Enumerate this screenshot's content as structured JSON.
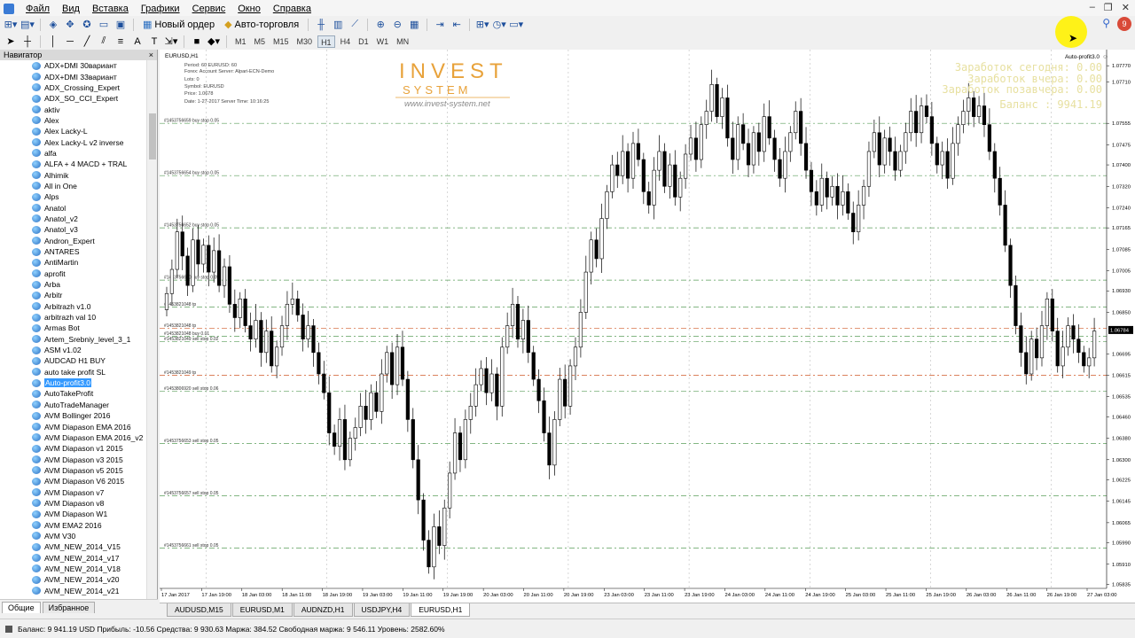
{
  "menu": [
    "Файл",
    "Вид",
    "Вставка",
    "Графики",
    "Сервис",
    "Окно",
    "Справка"
  ],
  "toolbar": {
    "new_order": "Новый ордер",
    "autotrading": "Авто-торговля"
  },
  "timeframes": [
    "M1",
    "M5",
    "M15",
    "M30",
    "H1",
    "H4",
    "D1",
    "W1",
    "MN"
  ],
  "active_timeframe": "H1",
  "navigator": {
    "title": "Навигатор",
    "items": [
      "ADX+DMI 30вариант",
      "ADX+DMI 33вариант",
      "ADX_Crossing_Expert",
      "ADX_SO_CCI_Expert",
      "aktiv",
      "Alex",
      "Alex Lacky-L",
      "Alex Lacky-L v2 inverse",
      "alfa",
      "ALFA + 4 MACD + TRAL",
      "Alhimik",
      "All in One",
      "Alps",
      "Anatol",
      "Anatol_v2",
      "Anatol_v3",
      "Andron_Expert",
      "ANTARES",
      "AntiMartin",
      "aprofit",
      "Arba",
      "Arbitr",
      "Arbitrazh v1.0",
      "arbitrazh val 10",
      "Armas Bot",
      "Artem_Srebniy_level_3_1",
      "ASM v1.02",
      "AUDCAD H1 BUY",
      "auto take profit SL",
      "Auto-profit3.0",
      "AutoTakeProfit",
      "AutoTradeManager",
      "AVM Bollinger 2016",
      "AVM Diapason EMA 2016",
      "AVM Diapason EMA 2016_v2",
      "AVM Diapason v1 2015",
      "AVM Diapason v3 2015",
      "AVM Diapason v5 2015",
      "AVM Diapason V6 2015",
      "AVM Diapason v7",
      "AVM Diapason v8",
      "AVM Diapason W1",
      "AVM EMA2 2016",
      "AVM V30",
      "AVM_NEW_2014_V15",
      "AVM_NEW_2014_v17",
      "AVM_NEW_2014_V18",
      "AVM_NEW_2014_v20",
      "AVM_NEW_2014_v21"
    ],
    "selected": "Auto-profit3.0",
    "tabs": [
      "Общие",
      "Избранное"
    ]
  },
  "chart": {
    "symbol_label": "EURUSD,H1",
    "expert_label": "Auto-profit3.0",
    "info_lines": [
      "Period: 60   EURUSD: 60",
      "Forex: Account Server: Alpari-ECN-Demo",
      "Lots: 0",
      "Symbol: EURUSD",
      "Price: 1.0678",
      "Date: 1-27-2017 Server Time: 10:16:25"
    ],
    "logo_line1": "INVEST",
    "logo_line2": "SYSTEM",
    "logo_url": "www.invest-system.net",
    "earnings": [
      "Заработок сегодня: 0.00",
      "Заработок вчера: 0.00",
      "Заработок позавчера: 0.00",
      "Баланс : 9941.19"
    ],
    "current_price": "1.06784"
  },
  "chart_data": {
    "type": "candlestick",
    "symbol": "EURUSD",
    "timeframe": "H1",
    "ylim": [
      1.0582,
      1.0783
    ],
    "y_ticks": [
      "1.07770",
      "1.07710",
      "1.07555",
      "1.07475",
      "1.07400",
      "1.07320",
      "1.07240",
      "1.07165",
      "1.07085",
      "1.07005",
      "1.06930",
      "1.06850",
      "1.06784",
      "1.06695",
      "1.06615",
      "1.06535",
      "1.06460",
      "1.06380",
      "1.06300",
      "1.06225",
      "1.06145",
      "1.06065",
      "1.05990",
      "1.05910",
      "1.05835"
    ],
    "x_ticks": [
      "17 Jan 2017",
      "17 Jan 19:00",
      "18 Jan 03:00",
      "18 Jan 11:00",
      "18 Jan 19:00",
      "19 Jan 03:00",
      "19 Jan 11:00",
      "19 Jan 19:00",
      "20 Jan 03:00",
      "20 Jan 11:00",
      "20 Jan 19:00",
      "23 Jan 03:00",
      "23 Jan 11:00",
      "23 Jan 19:00",
      "24 Jan 03:00",
      "24 Jan 11:00",
      "24 Jan 19:00",
      "25 Jan 03:00",
      "25 Jan 11:00",
      "25 Jan 19:00",
      "26 Jan 03:00",
      "26 Jan 11:00",
      "26 Jan 19:00",
      "27 Jan 03:00"
    ],
    "order_levels": [
      {
        "label": "#1453756659 buy stop 0.05",
        "price": 1.07555,
        "color": "#5a9e5a"
      },
      {
        "label": "#1453756654 buy stop 0.05",
        "price": 1.0736,
        "color": "#5a9e5a"
      },
      {
        "label": "#1453756652 buy stop 0.05",
        "price": 1.07165,
        "color": "#5a9e5a"
      },
      {
        "label": "#1453756650 buy stop 0.05",
        "price": 1.0697,
        "color": "#5a9e5a"
      },
      {
        "label": "#1453821048 tp",
        "price": 1.0687,
        "color": "#5a9e5a"
      },
      {
        "label": "#1453821048 tp",
        "price": 1.0679,
        "color": "#d05a28"
      },
      {
        "label": "#1453821048 buy 0.01",
        "price": 1.0676,
        "color": "#5a9e5a"
      },
      {
        "label": "#1453821049 sell stop 0.02",
        "price": 1.0674,
        "color": "#5a9e5a"
      },
      {
        "label": "#1453821049 tp",
        "price": 1.06615,
        "color": "#d05a28"
      },
      {
        "label": "#1453806920 sell stop 0.06",
        "price": 1.06555,
        "color": "#5a9e5a"
      },
      {
        "label": "#1453756653 sell stop 0.05",
        "price": 1.0636,
        "color": "#5a9e5a"
      },
      {
        "label": "#1453756657 sell stop 0.05",
        "price": 1.06165,
        "color": "#5a9e5a"
      },
      {
        "label": "#1453756661 sell stop 0.05",
        "price": 1.0597,
        "color": "#5a9e5a"
      }
    ],
    "closes": [
      1.0692,
      1.0701,
      1.0715,
      1.0706,
      1.0695,
      1.0712,
      1.0703,
      1.071,
      1.07,
      1.0708,
      1.0695,
      1.0702,
      1.0688,
      1.0683,
      1.069,
      1.068,
      1.0675,
      1.0682,
      1.067,
      1.0678,
      1.0665,
      1.0672,
      1.068,
      1.0688,
      1.069,
      1.0684,
      1.0675,
      1.068,
      1.067,
      1.0662,
      1.0655,
      1.064,
      1.0635,
      1.0645,
      1.063,
      1.0638,
      1.0642,
      1.065,
      1.0645,
      1.0655,
      1.0648,
      1.0662,
      1.067,
      1.0658,
      1.0672,
      1.066,
      1.0645,
      1.063,
      1.0615,
      1.06,
      1.059,
      1.0605,
      1.0598,
      1.0612,
      1.0625,
      1.064,
      1.063,
      1.0645,
      1.065,
      1.0658,
      1.0664,
      1.0655,
      1.0662,
      1.065,
      1.0672,
      1.068,
      1.0688,
      1.0675,
      1.0682,
      1.067,
      1.066,
      1.0652,
      1.064,
      1.0628,
      1.0645,
      1.066,
      1.065,
      1.0665,
      1.0672,
      1.0685,
      1.07,
      1.0712,
      1.0705,
      1.072,
      1.073,
      1.074,
      1.0736,
      1.0745,
      1.0735,
      1.0748,
      1.0742,
      1.073,
      1.0725,
      1.0738,
      1.0745,
      1.0732,
      1.074,
      1.0728,
      1.0735,
      1.0744,
      1.075,
      1.0742,
      1.0755,
      1.076,
      1.077,
      1.0758,
      1.0765,
      1.075,
      1.0742,
      1.0755,
      1.0748,
      1.074,
      1.0752,
      1.0745,
      1.0758,
      1.075,
      1.0742,
      1.0735,
      1.0745,
      1.0752,
      1.076,
      1.0748,
      1.0738,
      1.073,
      1.0725,
      1.0735,
      1.0728,
      1.0732,
      1.0725,
      1.073,
      1.0722,
      1.0715,
      1.0725,
      1.0732,
      1.0745,
      1.0752,
      1.074,
      1.075,
      1.0745,
      1.0738,
      1.0745,
      1.0752,
      1.076,
      1.0752,
      1.0762,
      1.0758,
      1.0748,
      1.074,
      1.0745,
      1.0735,
      1.0748,
      1.0755,
      1.076,
      1.0765,
      1.0758,
      1.0762,
      1.0755,
      1.0745,
      1.0735,
      1.0725,
      1.071,
      1.0695,
      1.068,
      1.067,
      1.0662,
      1.0675,
      1.0668,
      1.068,
      1.069,
      1.0678,
      1.0665,
      1.0672,
      1.068,
      1.0675,
      1.067,
      1.0665,
      1.0668,
      1.0678
    ]
  },
  "chart_tabs": [
    "AUDUSD,M15",
    "EURUSD,M1",
    "AUDNZD,H1",
    "USDJPY,H4",
    "EURUSD,H1"
  ],
  "active_chart_tab": "EURUSD,H1",
  "status": "Баланс: 9 941.19 USD  Прибыль: -10.56  Средства: 9 930.63  Маржа: 384.52  Свободная маржа: 9 546.11  Уровень: 2582.60%"
}
